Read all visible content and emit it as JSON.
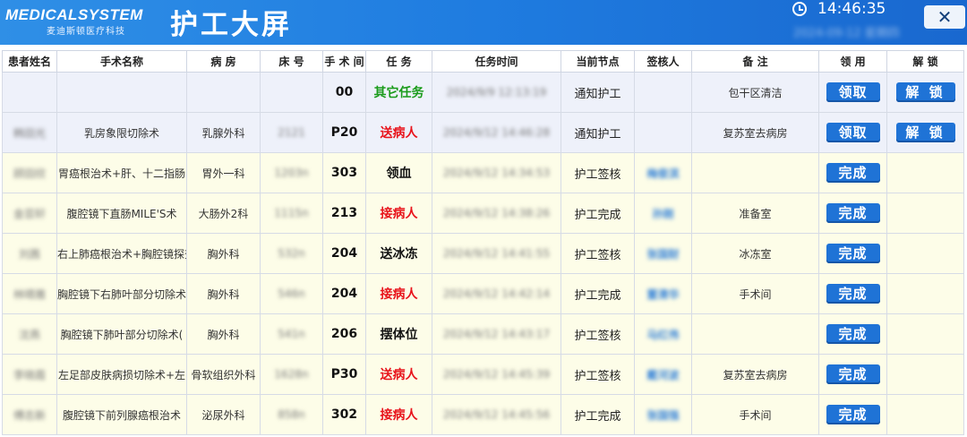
{
  "header": {
    "logo_en": "MEDICALSYSTEM",
    "logo_cn": "麦迪斯顿医疗科技",
    "title": "护工大屏",
    "time": "14:46:35",
    "date": "2024-09-12 星期四",
    "close_label": "✕"
  },
  "columns": [
    "患者姓名",
    "手术名称",
    "病 房",
    "床 号",
    "手 术 间",
    "任 务",
    "任务时间",
    "当前节点",
    "签核人",
    "备 注",
    "领 用",
    "解 锁"
  ],
  "colors": {
    "accent": "#1f73d6",
    "task_red": "#e8141c",
    "task_green": "#1a9b1a",
    "task_black": "#111111"
  },
  "rows": [
    {
      "style": "blue",
      "patient": "",
      "surgery": "",
      "ward": "",
      "bed": "",
      "room": "00",
      "task": "其它任务",
      "task_color": "#1a9b1a",
      "time": "2024/9/9 12:13:19",
      "node": "通知护工",
      "signer": "",
      "remark": "包干区清洁",
      "claim": "领取",
      "unlock": "解 锁"
    },
    {
      "style": "blue",
      "patient": "韩田光",
      "surgery": "乳房象限切除术",
      "ward": "乳腺外科",
      "bed": "2121",
      "room": "P20",
      "task": "送病人",
      "task_color": "#e8141c",
      "time": "2024/9/12 14:46:28",
      "node": "通知护工",
      "signer": "",
      "remark": "复苏室去病房",
      "claim": "领取",
      "unlock": "解 锁"
    },
    {
      "style": "yellow",
      "patient": "顾田欣",
      "surgery": "胃癌根治术+肝、十二指肠",
      "ward": "胃外一科",
      "bed": "1203n",
      "room": "303",
      "task": "领血",
      "task_color": "#111111",
      "time": "2024/9/12 14:34:53",
      "node": "护工签核",
      "signer": "梅俊滨",
      "remark": "",
      "claim": "完成",
      "unlock": ""
    },
    {
      "style": "yellow",
      "patient": "金芸轩",
      "surgery": "腹腔镜下直肠MILE'S术",
      "ward": "大肠外2科",
      "bed": "1115n",
      "room": "213",
      "task": "接病人",
      "task_color": "#e8141c",
      "time": "2024/9/12 14:38:26",
      "node": "护工完成",
      "signer": "孙刚",
      "remark": "准备室",
      "claim": "完成",
      "unlock": ""
    },
    {
      "style": "yellow",
      "patient": "刘茜",
      "surgery": "右上肺癌根治术+胸腔镜探查",
      "ward": "胸外科",
      "bed": "532n",
      "room": "204",
      "task": "送冰冻",
      "task_color": "#111111",
      "time": "2024/9/12 14:41:55",
      "node": "护工签核",
      "signer": "张国财",
      "remark": "冰冻室",
      "claim": "完成",
      "unlock": ""
    },
    {
      "style": "yellow",
      "patient": "林晴雅",
      "surgery": "胸腔镜下右肺叶部分切除术",
      "ward": "胸外科",
      "bed": "546n",
      "room": "204",
      "task": "接病人",
      "task_color": "#e8141c",
      "time": "2024/9/12 14:42:14",
      "node": "护工完成",
      "signer": "董清华",
      "remark": "手术间",
      "claim": "完成",
      "unlock": ""
    },
    {
      "style": "yellow",
      "patient": "沈燕",
      "surgery": "胸腔镜下肺叶部分切除术(",
      "ward": "胸外科",
      "bed": "541n",
      "room": "206",
      "task": "摆体位",
      "task_color": "#111111",
      "time": "2024/9/12 14:43:17",
      "node": "护工签核",
      "signer": "马红伟",
      "remark": "",
      "claim": "完成",
      "unlock": ""
    },
    {
      "style": "yellow",
      "patient": "李晓霞",
      "surgery": "左足部皮肤病损切除术+左",
      "ward": "骨软组织外科",
      "bed": "1628n",
      "room": "P30",
      "task": "送病人",
      "task_color": "#e8141c",
      "time": "2024/9/12 14:45:39",
      "node": "护工签核",
      "signer": "戴河波",
      "remark": "复苏室去病房",
      "claim": "完成",
      "unlock": ""
    },
    {
      "style": "yellow",
      "patient": "傅志新",
      "surgery": "腹腔镜下前列腺癌根治术",
      "ward": "泌尿外科",
      "bed": "858n",
      "room": "302",
      "task": "接病人",
      "task_color": "#e8141c",
      "time": "2024/9/12 14:45:56",
      "node": "护工完成",
      "signer": "张国强",
      "remark": "手术间",
      "claim": "完成",
      "unlock": ""
    }
  ]
}
